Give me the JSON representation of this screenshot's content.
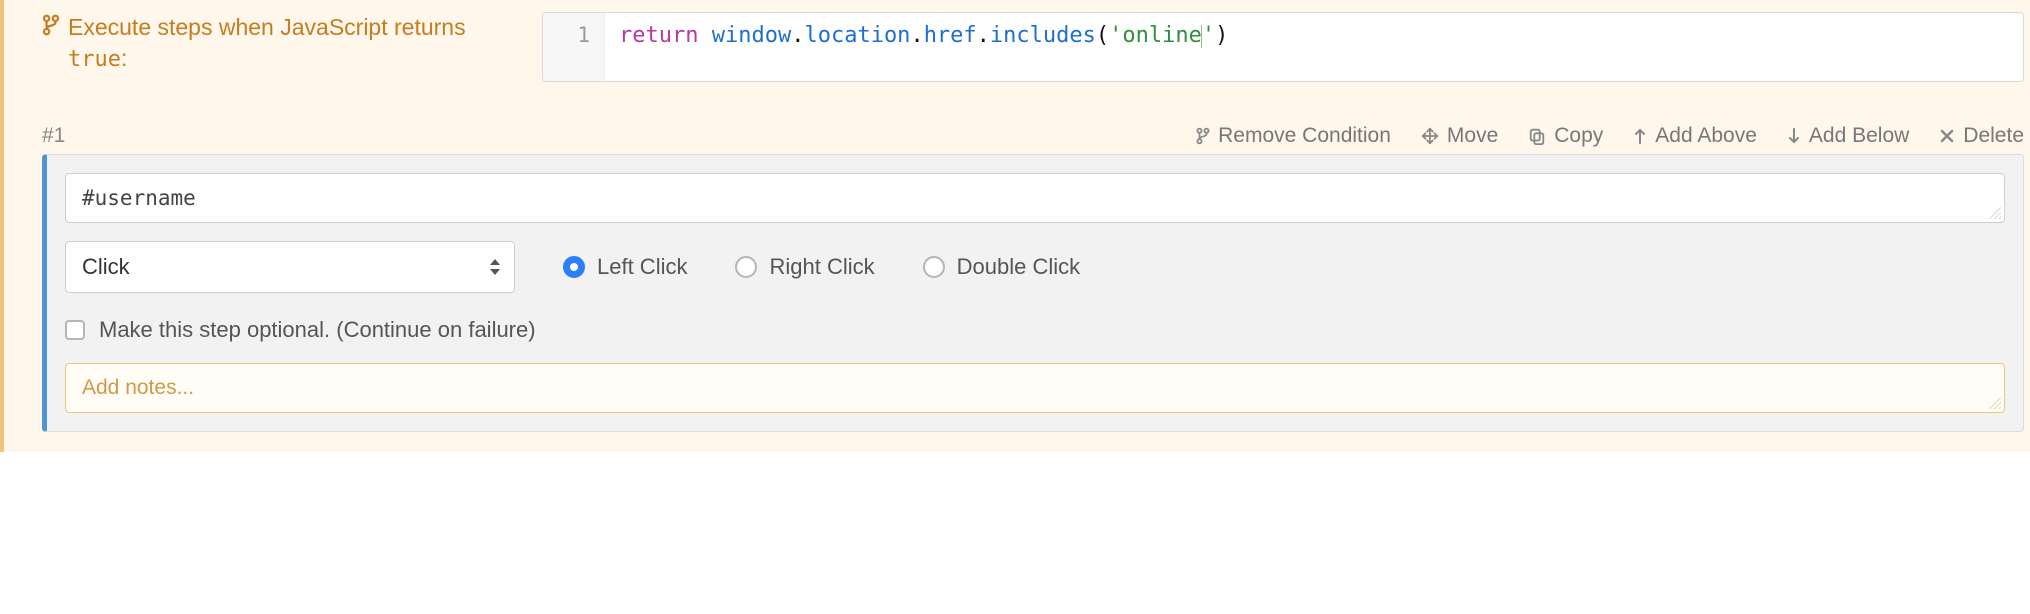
{
  "condition": {
    "label_prefix": "Execute steps when JavaScript returns ",
    "label_code": "true",
    "label_suffix": ":",
    "code": {
      "line_no": "1",
      "keyword": "return",
      "var": "window",
      "member": "location",
      "prop": "href",
      "fn": "includes",
      "str_open": "'",
      "str_body": "online",
      "str_close": "'"
    }
  },
  "step": {
    "number_label": "#1",
    "toolbar": {
      "remove_condition": "Remove Condition",
      "move": "Move",
      "copy": "Copy",
      "add_above": "Add Above",
      "add_below": "Add Below",
      "delete": "Delete"
    },
    "selector_value": "#username",
    "action_selected": "Click",
    "click_options": {
      "left": "Left Click",
      "right": "Right Click",
      "double": "Double Click",
      "selected": "left"
    },
    "optional_label": "Make this step optional. (Continue on failure)",
    "optional_checked": false,
    "notes_placeholder": "Add notes...",
    "notes_value": ""
  }
}
